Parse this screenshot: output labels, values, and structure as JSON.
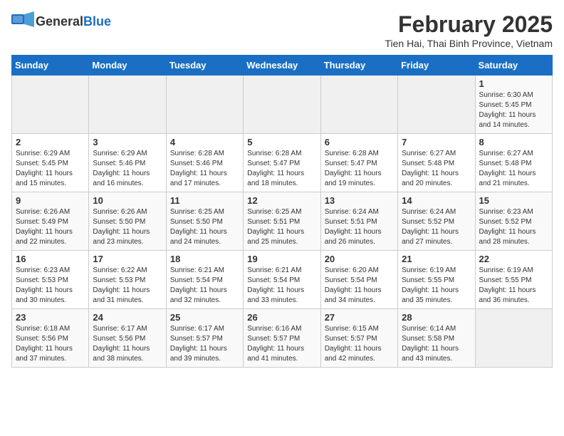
{
  "logo": {
    "general": "General",
    "blue": "Blue"
  },
  "title": "February 2025",
  "location": "Tien Hai, Thai Binh Province, Vietnam",
  "headers": [
    "Sunday",
    "Monday",
    "Tuesday",
    "Wednesday",
    "Thursday",
    "Friday",
    "Saturday"
  ],
  "weeks": [
    [
      {
        "day": "",
        "info": ""
      },
      {
        "day": "",
        "info": ""
      },
      {
        "day": "",
        "info": ""
      },
      {
        "day": "",
        "info": ""
      },
      {
        "day": "",
        "info": ""
      },
      {
        "day": "",
        "info": ""
      },
      {
        "day": "1",
        "info": "Sunrise: 6:30 AM\nSunset: 5:45 PM\nDaylight: 11 hours\nand 14 minutes."
      }
    ],
    [
      {
        "day": "2",
        "info": "Sunrise: 6:29 AM\nSunset: 5:45 PM\nDaylight: 11 hours\nand 15 minutes."
      },
      {
        "day": "3",
        "info": "Sunrise: 6:29 AM\nSunset: 5:46 PM\nDaylight: 11 hours\nand 16 minutes."
      },
      {
        "day": "4",
        "info": "Sunrise: 6:28 AM\nSunset: 5:46 PM\nDaylight: 11 hours\nand 17 minutes."
      },
      {
        "day": "5",
        "info": "Sunrise: 6:28 AM\nSunset: 5:47 PM\nDaylight: 11 hours\nand 18 minutes."
      },
      {
        "day": "6",
        "info": "Sunrise: 6:28 AM\nSunset: 5:47 PM\nDaylight: 11 hours\nand 19 minutes."
      },
      {
        "day": "7",
        "info": "Sunrise: 6:27 AM\nSunset: 5:48 PM\nDaylight: 11 hours\nand 20 minutes."
      },
      {
        "day": "8",
        "info": "Sunrise: 6:27 AM\nSunset: 5:48 PM\nDaylight: 11 hours\nand 21 minutes."
      }
    ],
    [
      {
        "day": "9",
        "info": "Sunrise: 6:26 AM\nSunset: 5:49 PM\nDaylight: 11 hours\nand 22 minutes."
      },
      {
        "day": "10",
        "info": "Sunrise: 6:26 AM\nSunset: 5:50 PM\nDaylight: 11 hours\nand 23 minutes."
      },
      {
        "day": "11",
        "info": "Sunrise: 6:25 AM\nSunset: 5:50 PM\nDaylight: 11 hours\nand 24 minutes."
      },
      {
        "day": "12",
        "info": "Sunrise: 6:25 AM\nSunset: 5:51 PM\nDaylight: 11 hours\nand 25 minutes."
      },
      {
        "day": "13",
        "info": "Sunrise: 6:24 AM\nSunset: 5:51 PM\nDaylight: 11 hours\nand 26 minutes."
      },
      {
        "day": "14",
        "info": "Sunrise: 6:24 AM\nSunset: 5:52 PM\nDaylight: 11 hours\nand 27 minutes."
      },
      {
        "day": "15",
        "info": "Sunrise: 6:23 AM\nSunset: 5:52 PM\nDaylight: 11 hours\nand 28 minutes."
      }
    ],
    [
      {
        "day": "16",
        "info": "Sunrise: 6:23 AM\nSunset: 5:53 PM\nDaylight: 11 hours\nand 30 minutes."
      },
      {
        "day": "17",
        "info": "Sunrise: 6:22 AM\nSunset: 5:53 PM\nDaylight: 11 hours\nand 31 minutes."
      },
      {
        "day": "18",
        "info": "Sunrise: 6:21 AM\nSunset: 5:54 PM\nDaylight: 11 hours\nand 32 minutes."
      },
      {
        "day": "19",
        "info": "Sunrise: 6:21 AM\nSunset: 5:54 PM\nDaylight: 11 hours\nand 33 minutes."
      },
      {
        "day": "20",
        "info": "Sunrise: 6:20 AM\nSunset: 5:54 PM\nDaylight: 11 hours\nand 34 minutes."
      },
      {
        "day": "21",
        "info": "Sunrise: 6:19 AM\nSunset: 5:55 PM\nDaylight: 11 hours\nand 35 minutes."
      },
      {
        "day": "22",
        "info": "Sunrise: 6:19 AM\nSunset: 5:55 PM\nDaylight: 11 hours\nand 36 minutes."
      }
    ],
    [
      {
        "day": "23",
        "info": "Sunrise: 6:18 AM\nSunset: 5:56 PM\nDaylight: 11 hours\nand 37 minutes."
      },
      {
        "day": "24",
        "info": "Sunrise: 6:17 AM\nSunset: 5:56 PM\nDaylight: 11 hours\nand 38 minutes."
      },
      {
        "day": "25",
        "info": "Sunrise: 6:17 AM\nSunset: 5:57 PM\nDaylight: 11 hours\nand 39 minutes."
      },
      {
        "day": "26",
        "info": "Sunrise: 6:16 AM\nSunset: 5:57 PM\nDaylight: 11 hours\nand 41 minutes."
      },
      {
        "day": "27",
        "info": "Sunrise: 6:15 AM\nSunset: 5:57 PM\nDaylight: 11 hours\nand 42 minutes."
      },
      {
        "day": "28",
        "info": "Sunrise: 6:14 AM\nSunset: 5:58 PM\nDaylight: 11 hours\nand 43 minutes."
      },
      {
        "day": "",
        "info": ""
      }
    ]
  ]
}
